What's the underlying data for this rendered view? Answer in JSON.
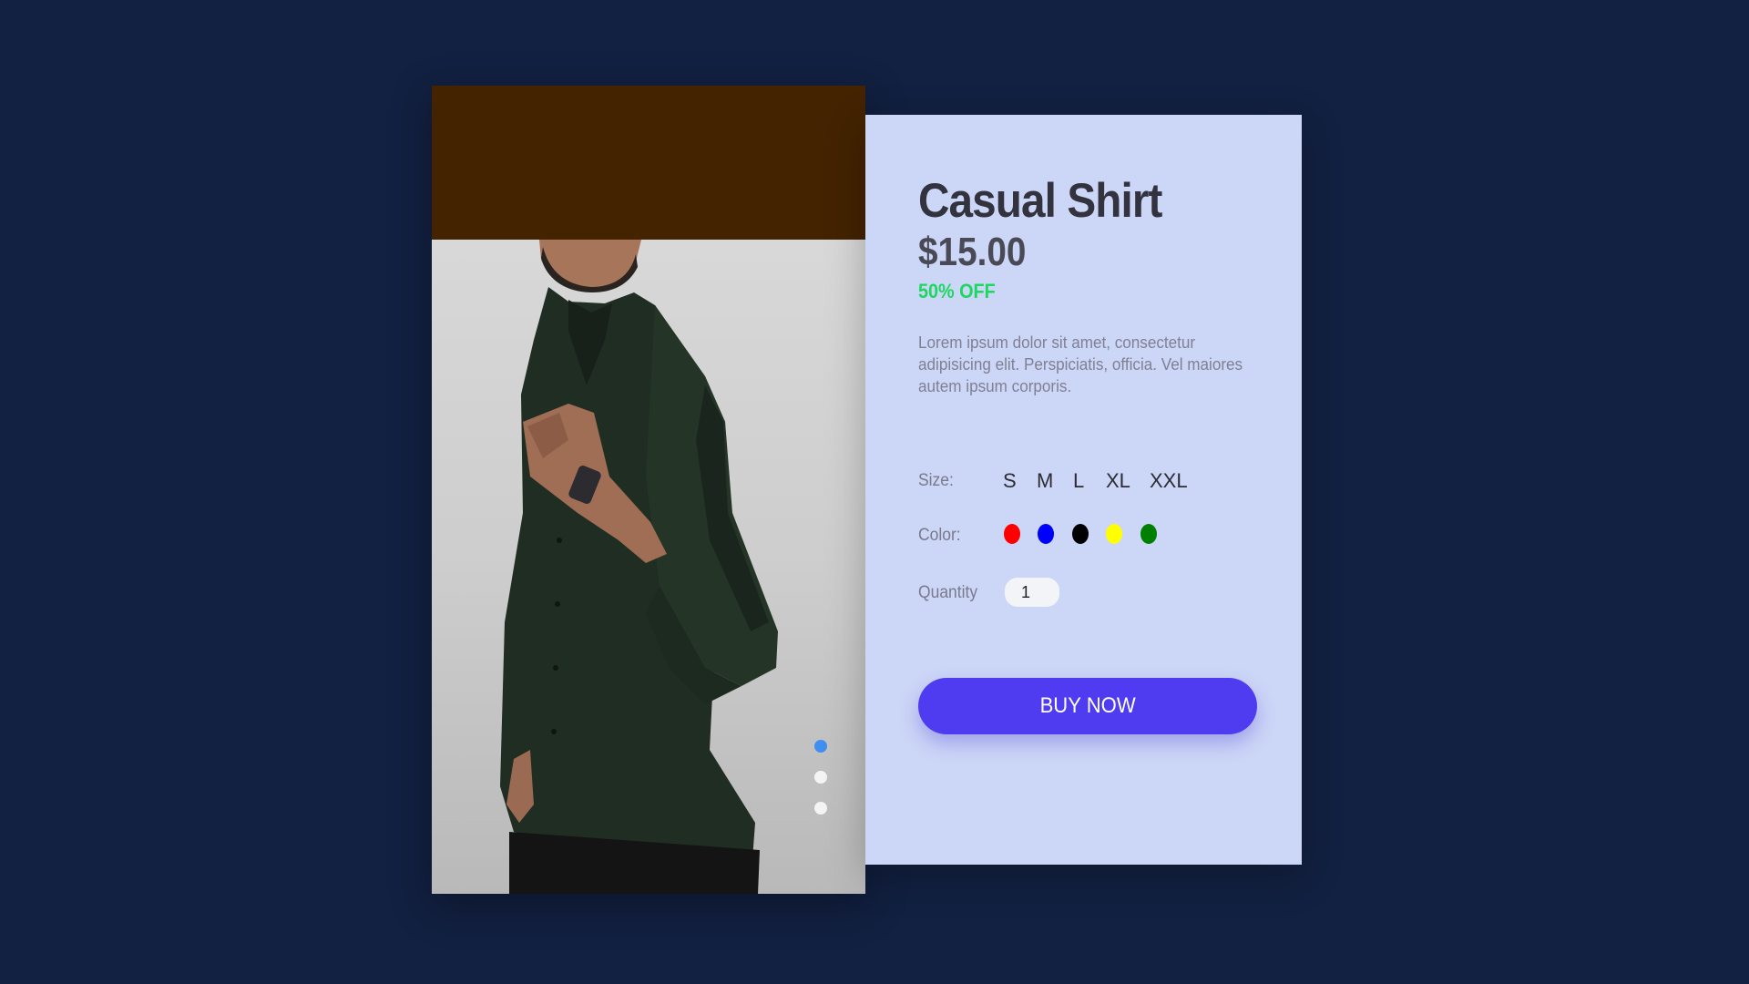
{
  "colors": {
    "page_background": "#122041",
    "image_top_band": "#432300",
    "details_background": "#ccd6f6",
    "discount": "#1ed760",
    "accent": "#4f3bf0",
    "dot_active": "#3f8ef0",
    "dot_inactive": "#f4f4f4"
  },
  "product": {
    "title": "Casual Shirt",
    "price": "$15.00",
    "discount": "50% OFF",
    "description": "Lorem ipsum dolor sit amet, consectetur adipisicing elit. Perspiciatis, officia. Vel maiores autem ipsum corporis."
  },
  "size": {
    "label": "Size:",
    "options": [
      "S",
      "M",
      "L",
      "XL",
      "XXL"
    ]
  },
  "color": {
    "label": "Color:",
    "options": [
      "#ff0000",
      "#0000ff",
      "#000000",
      "#ffff00",
      "#008000"
    ]
  },
  "quantity": {
    "label": "Quantity",
    "value": "1"
  },
  "buy_button": {
    "label": "BUY NOW"
  },
  "gallery": {
    "image": "product-photo-icon",
    "dots_count": 3,
    "active_dot": 1
  }
}
